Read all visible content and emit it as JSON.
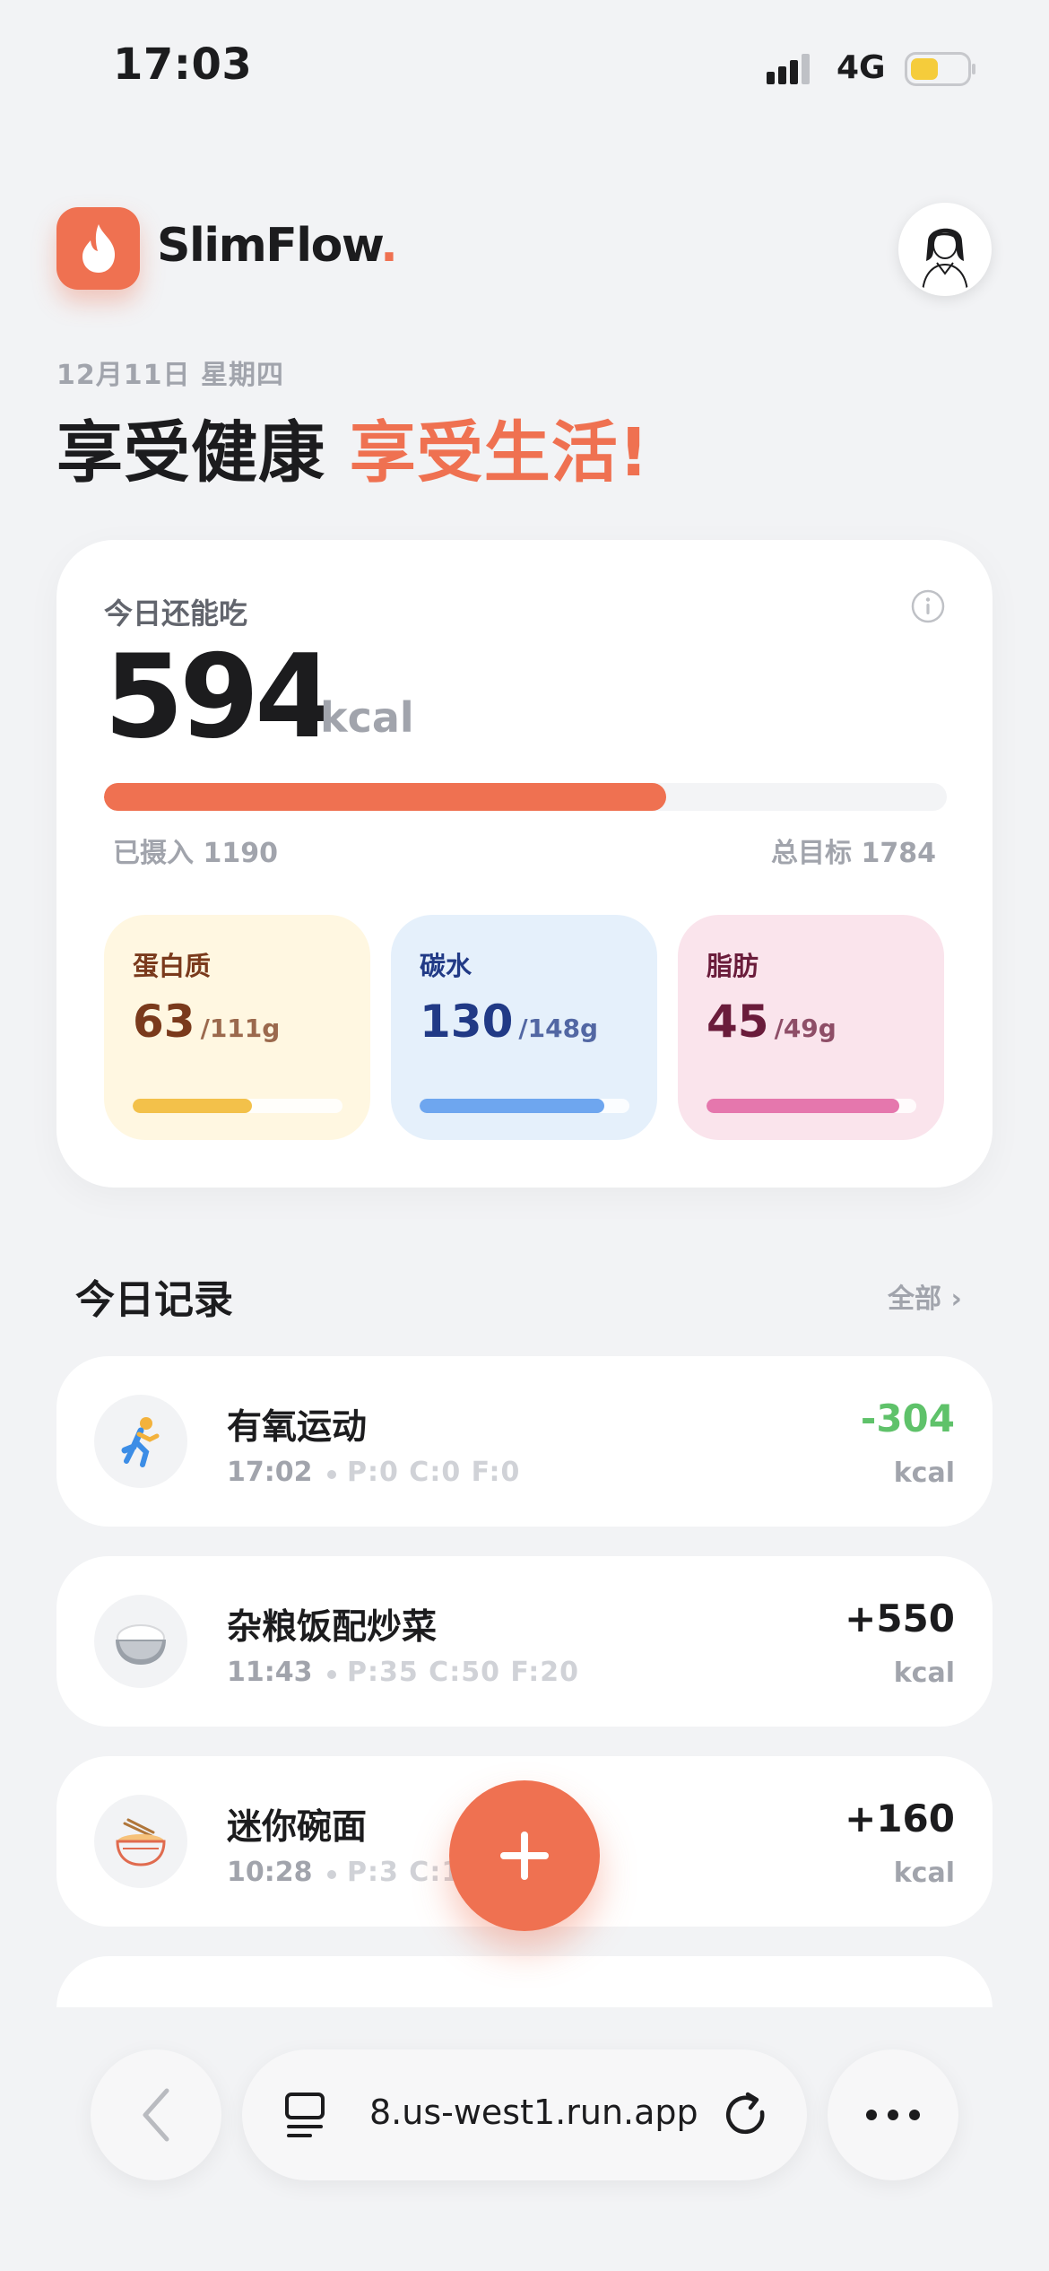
{
  "status_bar": {
    "time": "17:03",
    "network": "4G",
    "signal_icon": "signal-icon",
    "battery_icon": "battery-icon"
  },
  "header": {
    "brand": "SlimFlow",
    "brand_dot": ".",
    "logo_icon": "flame-icon",
    "avatar_icon": "user-avatar-illustration"
  },
  "hero": {
    "date": "12月11日 星期四",
    "headline_part1": "享受健康",
    "headline_part2": "享受生活!"
  },
  "summary": {
    "label": "今日还能吃",
    "remaining": "594",
    "unit": "kcal",
    "eaten_text": "已摄入 1190",
    "goal_text": "总目标 1784",
    "progress_fraction": 0.667,
    "info_icon": "info-icon"
  },
  "macros": [
    {
      "label": "蛋白质",
      "value": "63",
      "total": "/111g",
      "fraction": 0.57,
      "bg": "#fff7e1",
      "text": "#7a3a1c",
      "bar": "#f3c14a"
    },
    {
      "label": "碳水",
      "value": "130",
      "total": "/148g",
      "fraction": 0.88,
      "bg": "#e5f0fb",
      "text": "#213a86",
      "bar": "#6ea6ef"
    },
    {
      "label": "脂肪",
      "value": "45",
      "total": "/49g",
      "fraction": 0.92,
      "bg": "#fae4ec",
      "text": "#6a1c3b",
      "bar": "#e577ad"
    }
  ],
  "records_section": {
    "title": "今日记录",
    "see_all": "全部 ›"
  },
  "records": [
    {
      "icon": "runner-icon",
      "title": "有氧运动",
      "time": "17:02",
      "macros": "P:0 C:0 F:0",
      "kcal": "-304",
      "unit": "kcal",
      "kcal_color": "#5fc26a"
    },
    {
      "icon": "rice-bowl-icon",
      "title": "杂粮饭配炒菜",
      "time": "11:43",
      "macros": "P:35 C:50 F:20",
      "kcal": "+550",
      "unit": "kcal",
      "kcal_color": "#1c1c1e"
    },
    {
      "icon": "noodle-bowl-icon",
      "title": "迷你碗面",
      "time": "10:28",
      "macros": "P:3 C:1",
      "kcal": "+160",
      "unit": "kcal",
      "kcal_color": "#1c1c1e"
    }
  ],
  "fab": {
    "icon": "plus-icon"
  },
  "browser": {
    "url": "8.us-west1.run.app",
    "back_icon": "chevron-left-icon",
    "tabs_icon": "tabs-icon",
    "reload_icon": "reload-icon",
    "more_icon": "more-icon"
  },
  "colors": {
    "accent": "#ef7151",
    "background": "#f2f3f5",
    "negative_kcal": "#5fc26a"
  }
}
